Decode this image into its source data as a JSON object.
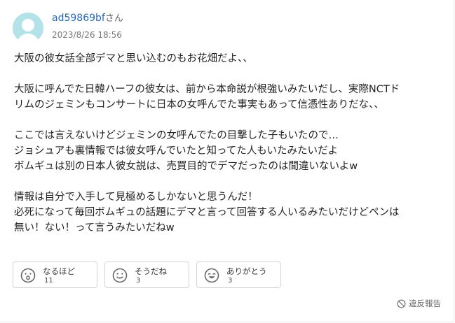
{
  "author": {
    "username": "ad59869bf",
    "suffix": "さん",
    "timestamp": "2023/8/26 18:56"
  },
  "comment": {
    "paragraphs": [
      [
        "大阪の彼女話全部デマと思い込むのもお花畑だよ、、"
      ],
      [
        "大阪に呼んでた日韓ハーフの彼女は、前から本命説が根強いみたいだし、実際NCTド",
        "リムのジェミンもコンサートに日本の女呼んでた事実もあって信憑性ありだな、、"
      ],
      [
        "ここでは言えないけどジェミンの女呼んでたの目撃した子もいたので…",
        "ジョシュアも裏情報では彼女呼んでいたと知ってた人もいたみたいだよ",
        "ボムギュは別の日本人彼女説は、売買目的でデマだったのは間違いないよw"
      ],
      [
        "情報は自分で入手して見極めるしかないと思うんだ！",
        "必死になって毎回ボムギュの話題にデマと言って回答する人いるみたいだけどペンは",
        "無い！ない！って言うみたいだねw"
      ]
    ]
  },
  "reactions": [
    {
      "icon": "surprised-face-icon",
      "label": "なるほど",
      "count": "11"
    },
    {
      "icon": "neutral-smile-face-icon",
      "label": "そうだね",
      "count": "3"
    },
    {
      "icon": "happy-face-icon",
      "label": "ありがとう",
      "count": "3"
    }
  ],
  "report": {
    "label": "違反報告",
    "icon": "prohibited-icon"
  },
  "colors": {
    "username": "#2668b7",
    "avatar_bg": "#b3e3e8",
    "border": "#d4d4d4"
  }
}
